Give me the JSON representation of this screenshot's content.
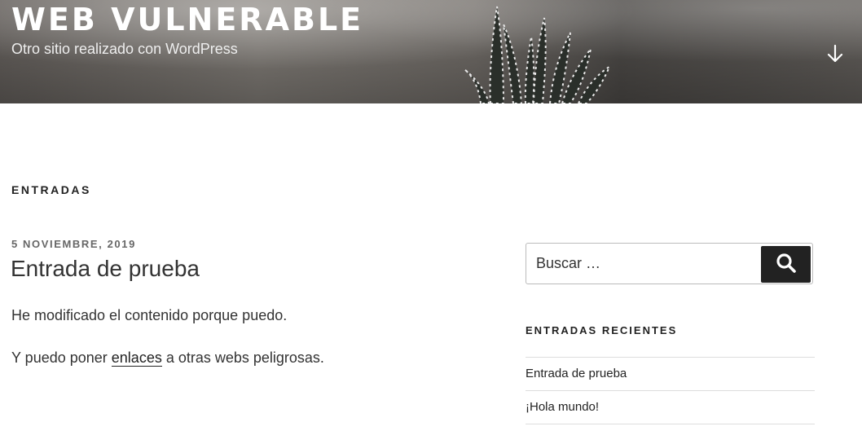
{
  "header": {
    "site_title": "WEB VULNERABLE",
    "site_description": "Otro sitio realizado con WordPress",
    "scroll_icon": "arrow-down-icon"
  },
  "main": {
    "heading": "ENTRADAS",
    "post": {
      "date": "5 NOVIEMBRE, 2019",
      "title": "Entrada de prueba",
      "paragraph1": "He modificado el contenido porque puedo.",
      "paragraph2_before": "Y puedo poner ",
      "paragraph2_link": "enlaces",
      "paragraph2_after": " a otras webs peligrosas."
    }
  },
  "sidebar": {
    "search": {
      "placeholder": "Buscar …",
      "button_icon": "search-icon"
    },
    "recent_posts": {
      "title": "ENTRADAS RECIENTES",
      "items": [
        {
          "label": "Entrada de prueba"
        },
        {
          "label": "¡Hola mundo!"
        }
      ]
    }
  },
  "colors": {
    "text": "#222222",
    "meta": "#666666",
    "button": "#222222"
  }
}
